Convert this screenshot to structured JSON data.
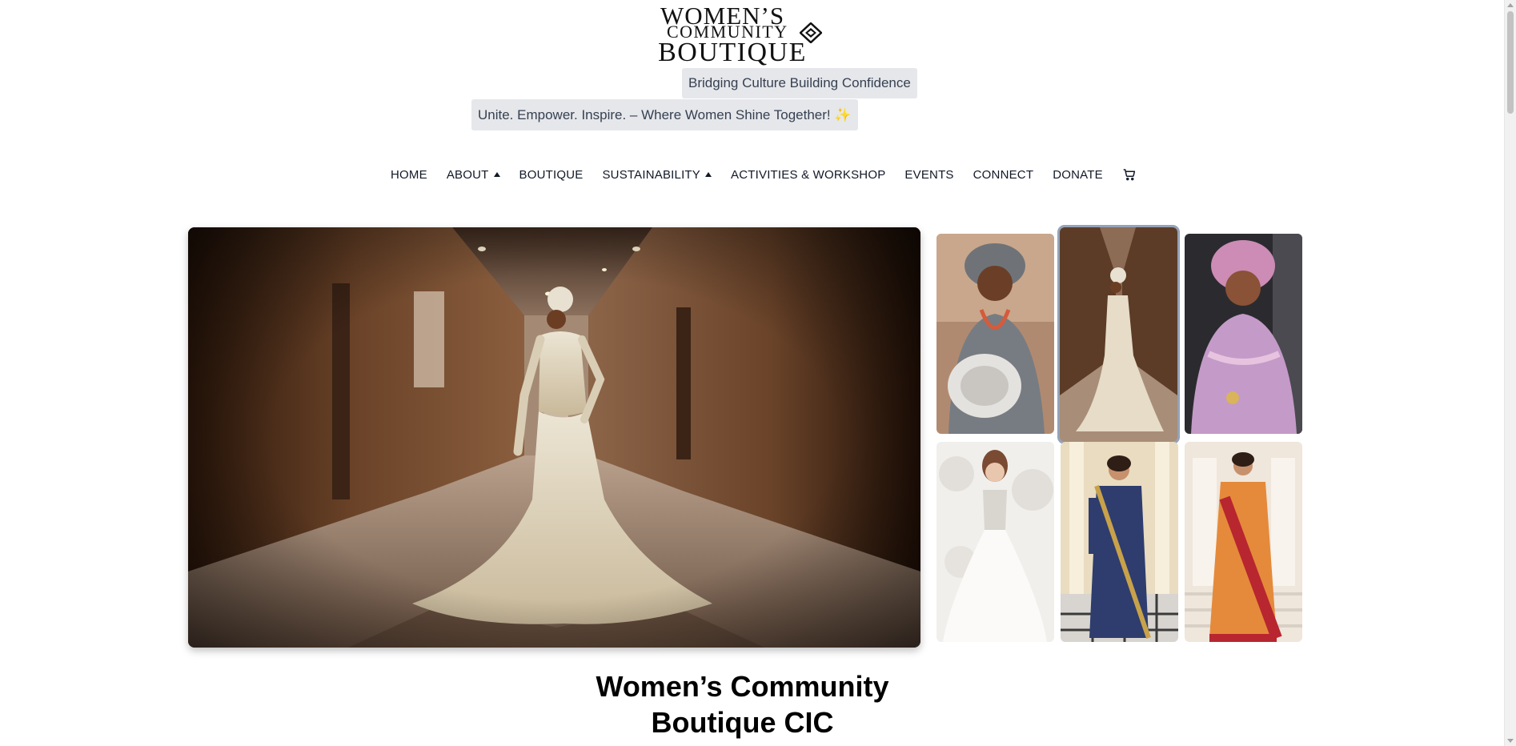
{
  "logo": {
    "line1": "WOMEN’S",
    "line2": "COMMUNITY",
    "line3": "BOUTIQUE"
  },
  "taglines": {
    "primary": "Bridging Culture Building Confidence",
    "secondary": "Unite. Empower. Inspire. – Where Women Shine Together! ✨"
  },
  "nav": {
    "items": [
      {
        "label": "HOME",
        "has_dropdown": false
      },
      {
        "label": "ABOUT",
        "has_dropdown": true
      },
      {
        "label": "BOUTIQUE",
        "has_dropdown": false
      },
      {
        "label": "SUSTAINABILITY",
        "has_dropdown": true
      },
      {
        "label": "ACTIVITIES & WORKSHOP",
        "has_dropdown": false
      },
      {
        "label": "EVENTS",
        "has_dropdown": false
      },
      {
        "label": "CONNECT",
        "has_dropdown": false
      },
      {
        "label": "DONATE",
        "has_dropdown": false
      }
    ],
    "cart_icon": "cart-icon"
  },
  "gallery": {
    "selected_index": 1,
    "thumbnails": [
      {
        "name": "thumb-grey-gele-outfit"
      },
      {
        "name": "thumb-cream-gown-hallway"
      },
      {
        "name": "thumb-pink-gele-outfit"
      },
      {
        "name": "thumb-white-ball-gown"
      },
      {
        "name": "thumb-navy-saree"
      },
      {
        "name": "thumb-orange-saree"
      }
    ]
  },
  "heading": {
    "line1": "Women’s Community",
    "line2": "Boutique CIC"
  },
  "colors": {
    "chip_bg": "#e5e7eb",
    "nav_text": "#111827",
    "selection_outline": "#94a3b8"
  }
}
